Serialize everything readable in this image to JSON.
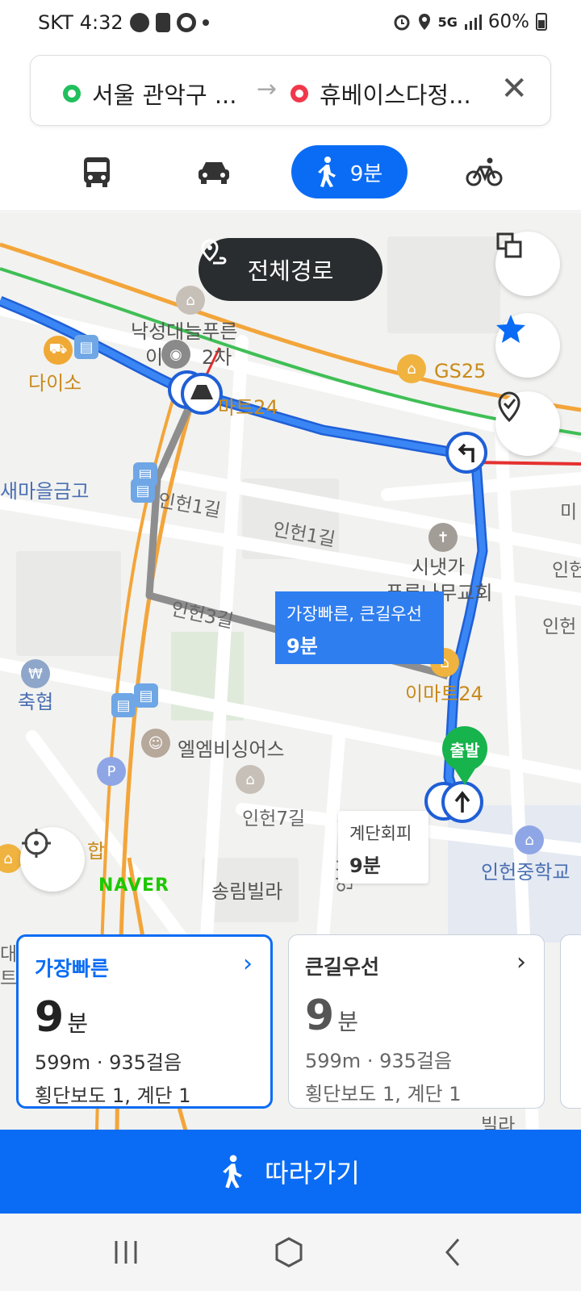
{
  "status_bar": {
    "carrier": "SKT",
    "time": "4:32",
    "network": "5G",
    "battery": "60%",
    "icons": [
      "talk-icon",
      "b-icon",
      "c-icon",
      "dot-icon",
      "alarm-icon",
      "location-icon",
      "signal-icon",
      "battery-icon"
    ]
  },
  "route_search": {
    "origin": "서울 관악구 ...",
    "destination": "휴베이스다정...",
    "arrow": "→",
    "close": "✕"
  },
  "mode_tabs": {
    "items": [
      "bus",
      "car",
      "walk",
      "bicycle"
    ],
    "active": "walk",
    "walk_time": "9분"
  },
  "map": {
    "full_route_button": "전체경로",
    "route_tooltip": {
      "title": "가장빠른, 큰길우선",
      "time": "9분"
    },
    "alt_tooltip": {
      "title": "계단회피",
      "time": "9분"
    },
    "start_marker": "출발",
    "logo": "NAVER",
    "labels": {
      "daiso": "다이소",
      "nakseong": "낙성대늘푸른",
      "nakseong2": "이",
      "nakseong3": "2차",
      "mart24_top": "마트24",
      "gs25": "GS25",
      "saemaeul": "새마을금고",
      "inheon1_a": "인헌1길",
      "inheon1_b": "인헌1길",
      "church_a": "시냇가",
      "church_b": "푸른나무교회",
      "inheon3": "인헌3길",
      "emart24": "이마트24",
      "chukhyup": "축협",
      "lmbusiness": "엘엠비싱어스",
      "inheon7": "인헌7길",
      "inheon11": "인헌11길",
      "songrim": "송림빌라",
      "inheon_school": "인헌중학교",
      "hap": "합",
      "mi": "미",
      "inheon_r1": "인헌",
      "inheon_r2": "인헌",
      "dae": "대",
      "teu": "트",
      "villa": "빌라"
    }
  },
  "route_cards": [
    {
      "title": "가장빠른",
      "time_num": "9",
      "time_unit": "분",
      "distance": "599m · 935걸음",
      "detail": "횡단보도 1, 계단 1"
    },
    {
      "title": "큰길우선",
      "time_num": "9",
      "time_unit": "분",
      "distance": "599m · 935걸음",
      "detail": "횡단보도 1, 계단 1"
    }
  ],
  "follow_button": "따라가기",
  "colors": {
    "accent": "#0a6cf5",
    "route": "#2f7ef0",
    "start_green": "#17b34c",
    "end_red": "#f0384a"
  }
}
